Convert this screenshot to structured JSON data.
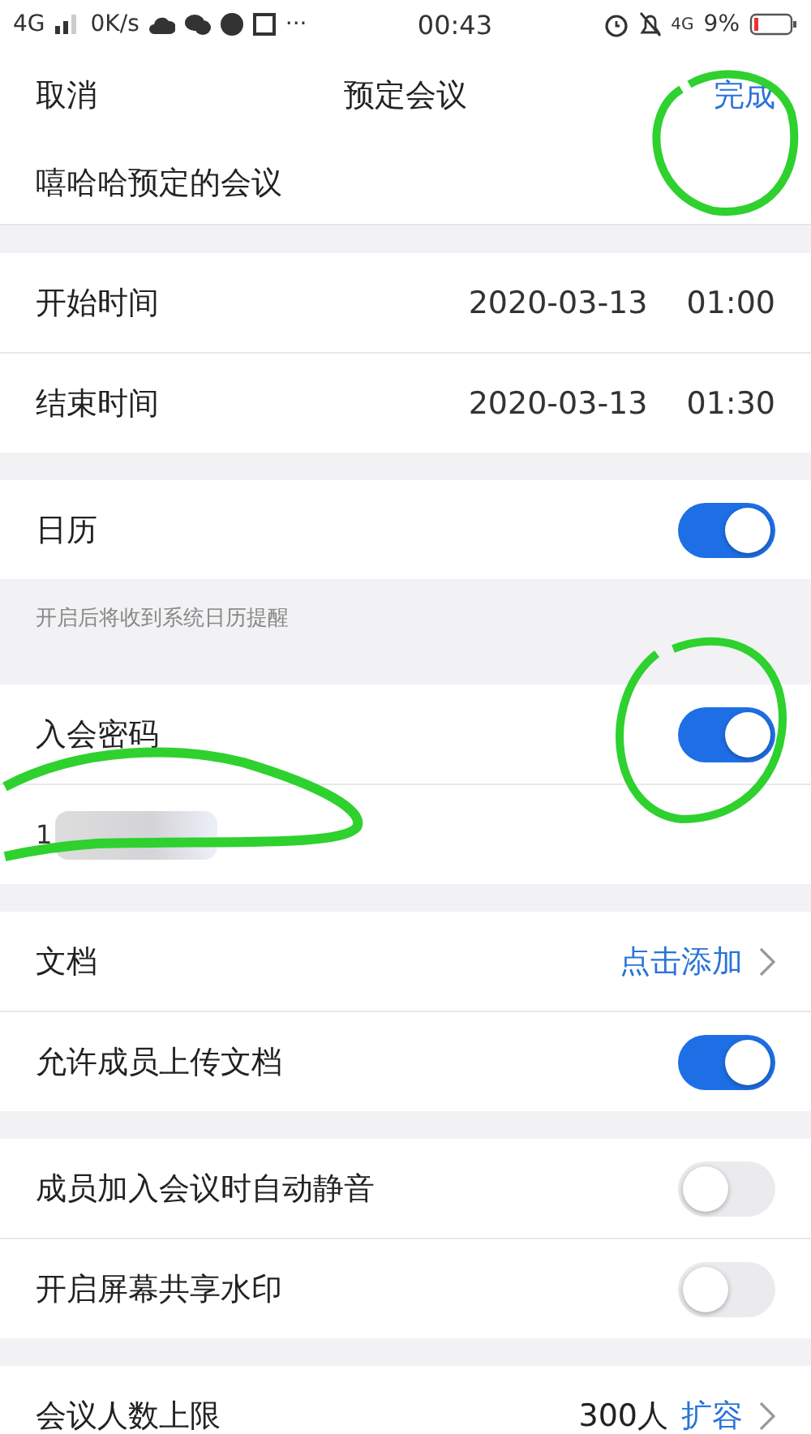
{
  "status_bar": {
    "network": "4G",
    "speed": "0K/s",
    "more": "···",
    "time": "00:43",
    "network_right": "4G",
    "battery": "9%"
  },
  "nav": {
    "cancel": "取消",
    "title": "预定会议",
    "done": "完成"
  },
  "subject": "嘻哈哈预定的会议",
  "groups": [
    {
      "rows": [
        {
          "kind": "datetime",
          "label": "开始时间",
          "date": "2020-03-13",
          "time": "01:00"
        },
        {
          "kind": "datetime",
          "label": "结束时间",
          "date": "2020-03-13",
          "time": "01:30"
        }
      ]
    },
    {
      "rows": [
        {
          "kind": "toggle",
          "label": "日历",
          "on": true
        }
      ],
      "hint": "开启后将收到系统日历提醒"
    },
    {
      "rows": [
        {
          "kind": "toggle",
          "label": "入会密码",
          "on": true
        },
        {
          "kind": "secret",
          "value": "1"
        }
      ]
    },
    {
      "rows": [
        {
          "kind": "link",
          "label": "文档",
          "action": "点击添加"
        },
        {
          "kind": "toggle",
          "label": "允许成员上传文档",
          "on": true
        }
      ]
    },
    {
      "rows": [
        {
          "kind": "toggle",
          "label": "成员加入会议时自动静音",
          "on": false
        },
        {
          "kind": "toggle",
          "label": "开启屏幕共享水印",
          "on": false
        }
      ]
    },
    {
      "rows": [
        {
          "kind": "link",
          "label": "会议人数上限",
          "value": "300人",
          "action": "扩容"
        }
      ]
    }
  ]
}
